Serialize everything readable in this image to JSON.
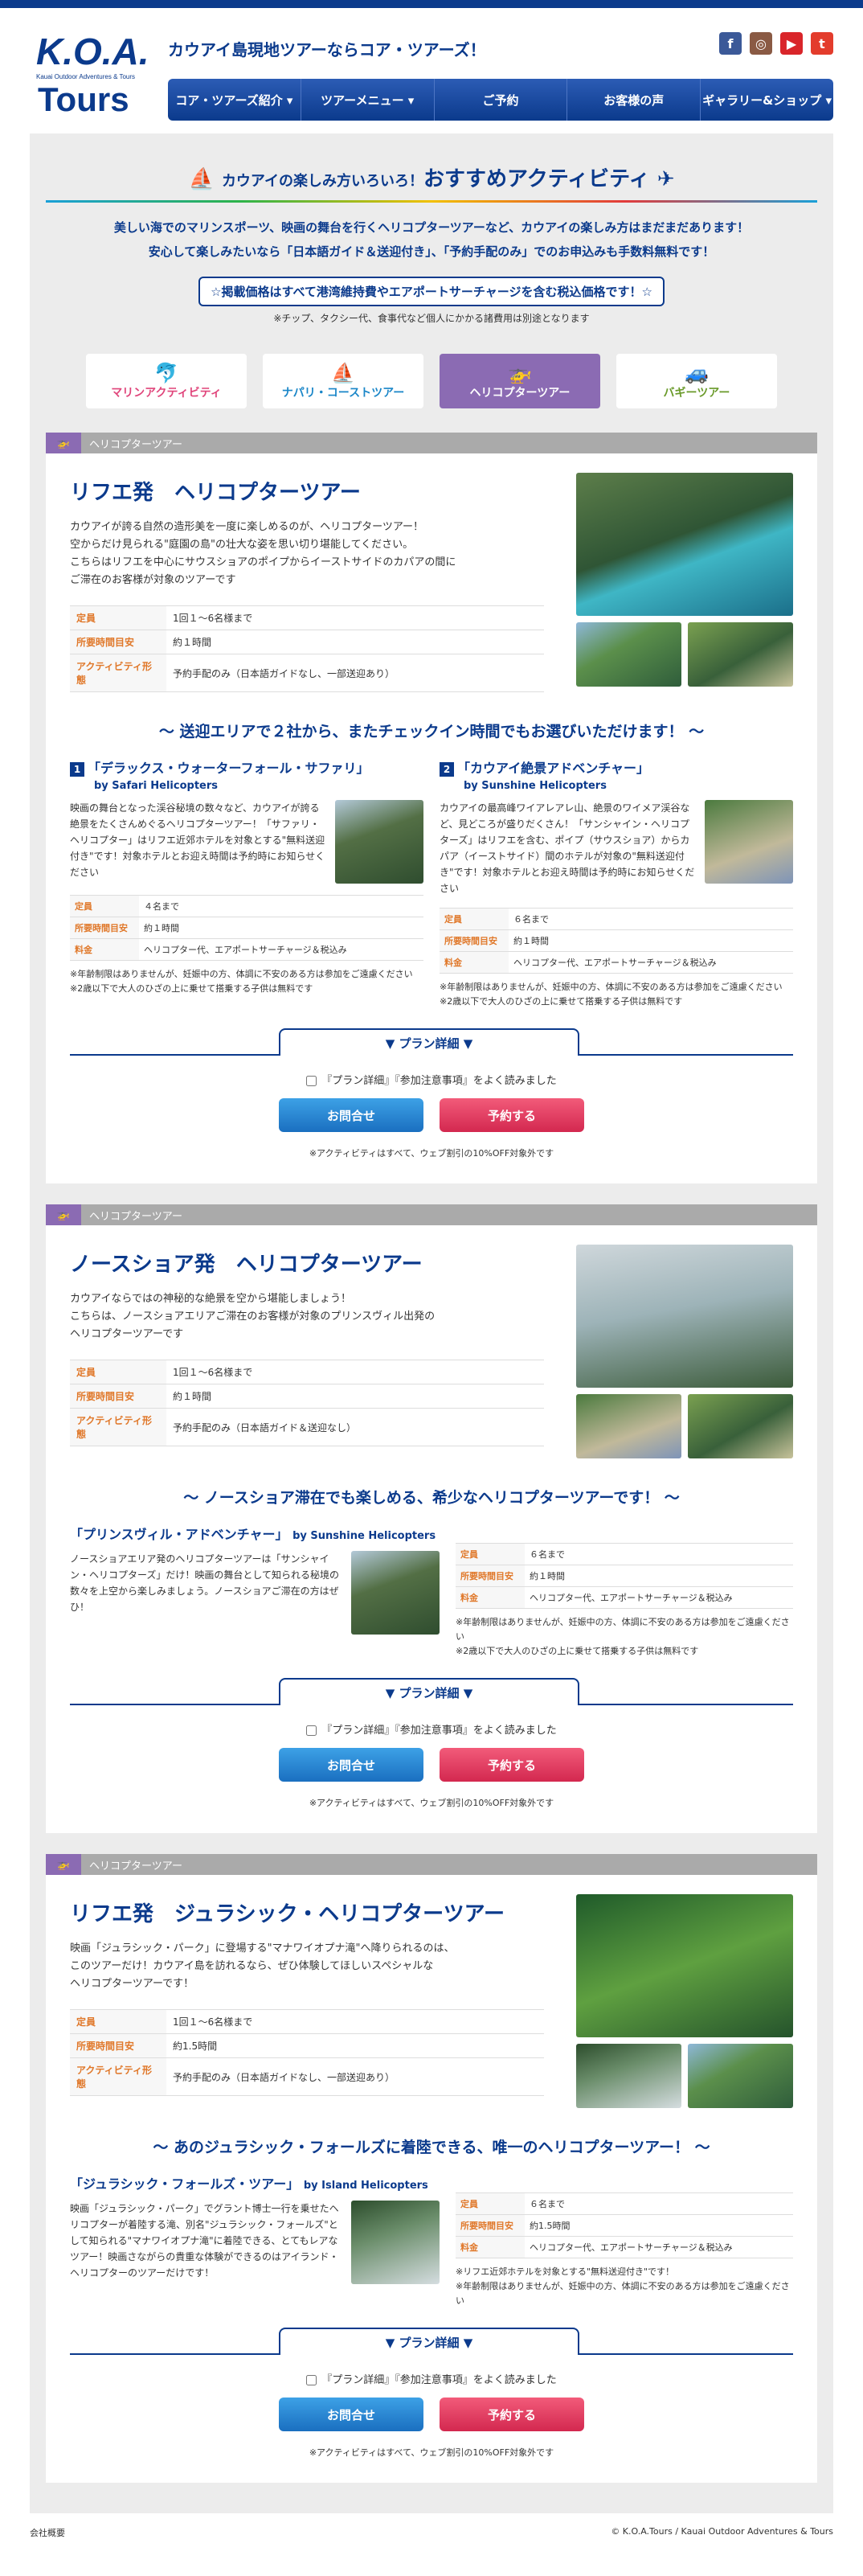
{
  "header": {
    "logo_text": "K.O.A. Tours",
    "logo_subtitle": "Kauai Outdoor Adventures & Tours",
    "tagline": "カウアイ島現地ツアーならコア・ツアーズ！",
    "social": {
      "facebook": "f",
      "instagram": "◎",
      "youtube": "▶",
      "twitter": "t"
    }
  },
  "nav": [
    "コア・ツアーズ紹介 ▾",
    "ツアーメニュー ▾",
    "ご予約",
    "お客様の声",
    "ギャラリー&ショップ ▾"
  ],
  "intro": {
    "title_small": "カウアイの楽しみ方いろいろ！",
    "title_big": "おすすめアクティビティ",
    "line1": "美しい海でのマリンスポーツ、映画の舞台を行くヘリコプターツアーなど、カウアイの楽しみ方はまだまだあります！",
    "line2": "安心して楽しみたいなら「日本語ガイド＆送迎付き」、「予約手配のみ」でのお申込みも手数料無料です！",
    "price_box": "☆掲載価格はすべて港湾維持費やエアポートサーチャージを含む税込価格です！☆",
    "price_note": "※チップ、タクシー代、食事代など個人にかかる諸費用は別途となります"
  },
  "categories": [
    "マリンアクティビティ",
    "ナパリ・コーストツアー",
    "ヘリコプターツアー",
    "バギーツアー"
  ],
  "common": {
    "section_label": "ヘリコプターツアー",
    "plan_detail": "▼ プラン詳細 ▼",
    "agree": "『プラン詳細』『参加注意事項』をよく読みました",
    "inquiry": "お問合せ",
    "book": "予約する",
    "web_note": "※アクティビティはすべて、ウェブ割引の10%OFF対象外です",
    "k_capacity": "定員",
    "k_time": "所要時間目安",
    "k_form": "アクティビティ形態",
    "k_capacity2": "定員",
    "k_time2": "所要時間目安",
    "k_fee": "料金"
  },
  "tours": [
    {
      "title": "リフエ発　ヘリコプターツアー",
      "desc1": "カウアイが誇る自然の造形美を一度に楽しめるのが、ヘリコプターツアー！",
      "desc2": "空からだけ見られる\"庭園の島\"の壮大な姿を思い切り堪能してください。",
      "desc3": "こちらはリフエを中心にサウスショアのポイプからイーストサイドのカパアの間に",
      "desc4": "ご滞在のお客様が対象のツアーです",
      "capacity": "1回１〜6名様まで",
      "time": "約１時間",
      "form": "予約手配のみ（日本語ガイドなし、一部送迎あり）",
      "sub_head": "〜 送迎エリアで２社から、またチェックイン時間でもお選びいただけます！ 〜",
      "plans": [
        {
          "num": "1",
          "title": "「デラックス・ウォーターフォール・サファリ」",
          "by": "by Safari Helicopters",
          "text": "映画の舞台となった渓谷秘境の数々など、カウアイが誇る絶景をたくさんめぐるヘリコプターツアー！「サファリ・ヘリコプター」はリフエ近郊ホテルを対象とする\"無料送迎付き\"です！対象ホテルとお迎え時間は予約時にお知らせください",
          "capacity": "４名まで",
          "time": "約１時間",
          "fee": "ヘリコプター代、エアポートサーチャージ＆税込み",
          "note1": "※年齢制限はありませんが、妊娠中の方、体調に不安のある方は参加をご遠慮ください",
          "note2": "※2歳以下で大人のひざの上に乗せて搭乗する子供は無料です"
        },
        {
          "num": "2",
          "title": "「カウアイ絶景アドベンチャー」",
          "by": "by Sunshine Helicopters",
          "text": "カウアイの最高峰ワイアレアレ山、絶景のワイメア渓谷など、見どころが盛りだくさん！「サンシャイン・ヘリコプターズ」はリフエを含む、ポイプ（サウスショア）からカパア（イーストサイド）間のホテルが対象の\"無料送迎付き\"です！対象ホテルとお迎え時間は予約時にお知らせください",
          "capacity": "６名まで",
          "time": "約１時間",
          "fee": "ヘリコプター代、エアポートサーチャージ＆税込み",
          "note1": "※年齢制限はありませんが、妊娠中の方、体調に不安のある方は参加をご遠慮ください",
          "note2": "※2歳以下で大人のひざの上に乗せて搭乗する子供は無料です"
        }
      ]
    },
    {
      "title": "ノースショア発　ヘリコプターツアー",
      "desc1": "カウアイならではの神秘的な絶景を空から堪能しましょう！",
      "desc2": "こちらは、ノースショアエリアご滞在のお客様が対象のプリンスヴィル出発の",
      "desc3": "ヘリコプターツアーです",
      "capacity": "1回１〜6名様まで",
      "time": "約１時間",
      "form": "予約手配のみ（日本語ガイド＆送迎なし）",
      "sub_head": "〜 ノースショア滞在でも楽しめる、希少なヘリコプターツアーです！ 〜",
      "plan": {
        "title": "「プリンスヴィル・アドベンチャー」",
        "by": "by Sunshine Helicopters",
        "text": "ノースショアエリア発のヘリコプターツアーは「サンシャイン・ヘリコプターズ」だけ！映画の舞台として知られる秘境の数々を上空から楽しみましょう。ノースショアご滞在の方はぜひ！",
        "capacity": "６名まで",
        "time": "約１時間",
        "fee": "ヘリコプター代、エアポートサーチャージ＆税込み",
        "note1": "※年齢制限はありませんが、妊娠中の方、体調に不安のある方は参加をご遠慮ください",
        "note2": "※2歳以下で大人のひざの上に乗せて搭乗する子供は無料です"
      }
    },
    {
      "title": "リフエ発　ジュラシック・ヘリコプターツアー",
      "desc1": "映画「ジュラシック・パーク」に登場する\"マナワイオプナ滝\"へ降りられるのは、",
      "desc2": "このツアーだけ！カウアイ島を訪れるなら、ぜひ体験してほしいスペシャルな",
      "desc3": "ヘリコプターツアーです！",
      "capacity": "1回１〜6名様まで",
      "time": "約1.5時間",
      "form": "予約手配のみ（日本語ガイドなし、一部送迎あり）",
      "sub_head": "〜 あのジュラシック・フォールズに着陸できる、唯一のヘリコプターツアー！ 〜",
      "plan": {
        "title": "「ジュラシック・フォールズ・ツアー」",
        "by": "by Island Helicopters",
        "text": "映画「ジュラシック・パーク」でグラント博士一行を乗せたヘリコプターが着陸する滝、別名\"ジュラシック・フォールズ\"として知られる\"マナワイオプナ滝\"に着陸できる、とてもレアなツアー！映画さながらの貴重な体験ができるのはアイランド・ヘリコプターのツアーだけです！",
        "capacity": "６名まで",
        "time": "約1.5時間",
        "fee": "ヘリコプター代、エアポートサーチャージ＆税込み",
        "note1": "※リフエ近郊ホテルを対象とする\"無料送迎付き\"です！",
        "note2": "※年齢制限はありませんが、妊娠中の方、体調に不安のある方は参加をご遠慮ください"
      }
    }
  ],
  "footer": {
    "left": "会社概要",
    "right": "© K.O.A.Tours / Kauai Outdoor Adventures & Tours"
  }
}
